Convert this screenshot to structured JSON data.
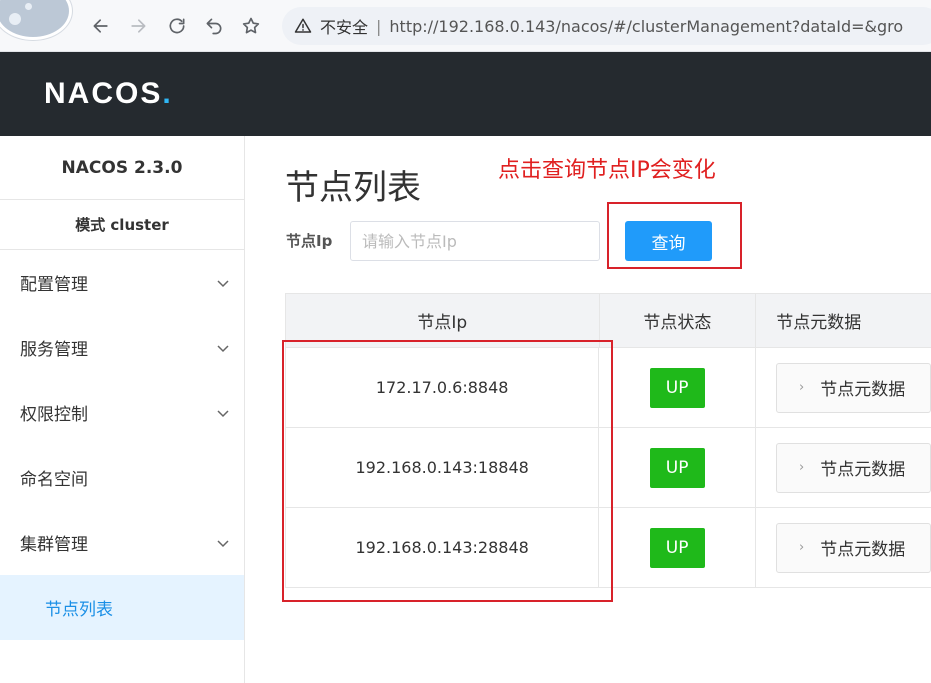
{
  "browser": {
    "insecure_label": "不安全",
    "separator": "|",
    "url": "http://192.168.0.143/nacos/#/clusterManagement?dataId=&gro"
  },
  "app": {
    "logo_text": "NACOS",
    "logo_dot": "."
  },
  "sidebar": {
    "version": "NACOS 2.3.0",
    "mode": "模式 cluster",
    "items": [
      {
        "label": "配置管理",
        "expandable": true
      },
      {
        "label": "服务管理",
        "expandable": true
      },
      {
        "label": "权限控制",
        "expandable": true
      },
      {
        "label": "命名空间",
        "expandable": false
      },
      {
        "label": "集群管理",
        "expandable": true
      }
    ],
    "active_sub": "节点列表"
  },
  "main": {
    "title": "节点列表",
    "annotation": "点击查询节点IP会变化",
    "filter_label": "节点Ip",
    "filter_placeholder": "请输入节点Ip",
    "query_button": "查询"
  },
  "table": {
    "headers": [
      "节点Ip",
      "节点状态",
      "节点元数据"
    ],
    "rows": [
      {
        "ip": "172.17.0.6:8848",
        "state": "UP",
        "meta": "节点元数据"
      },
      {
        "ip": "192.168.0.143:18848",
        "state": "UP",
        "meta": "节点元数据"
      },
      {
        "ip": "192.168.0.143:28848",
        "state": "UP",
        "meta": "节点元数据"
      }
    ]
  },
  "colors": {
    "accent": "#209bfa",
    "up": "#1fb91a",
    "annotation": "#e02020",
    "header": "#252a2f"
  }
}
